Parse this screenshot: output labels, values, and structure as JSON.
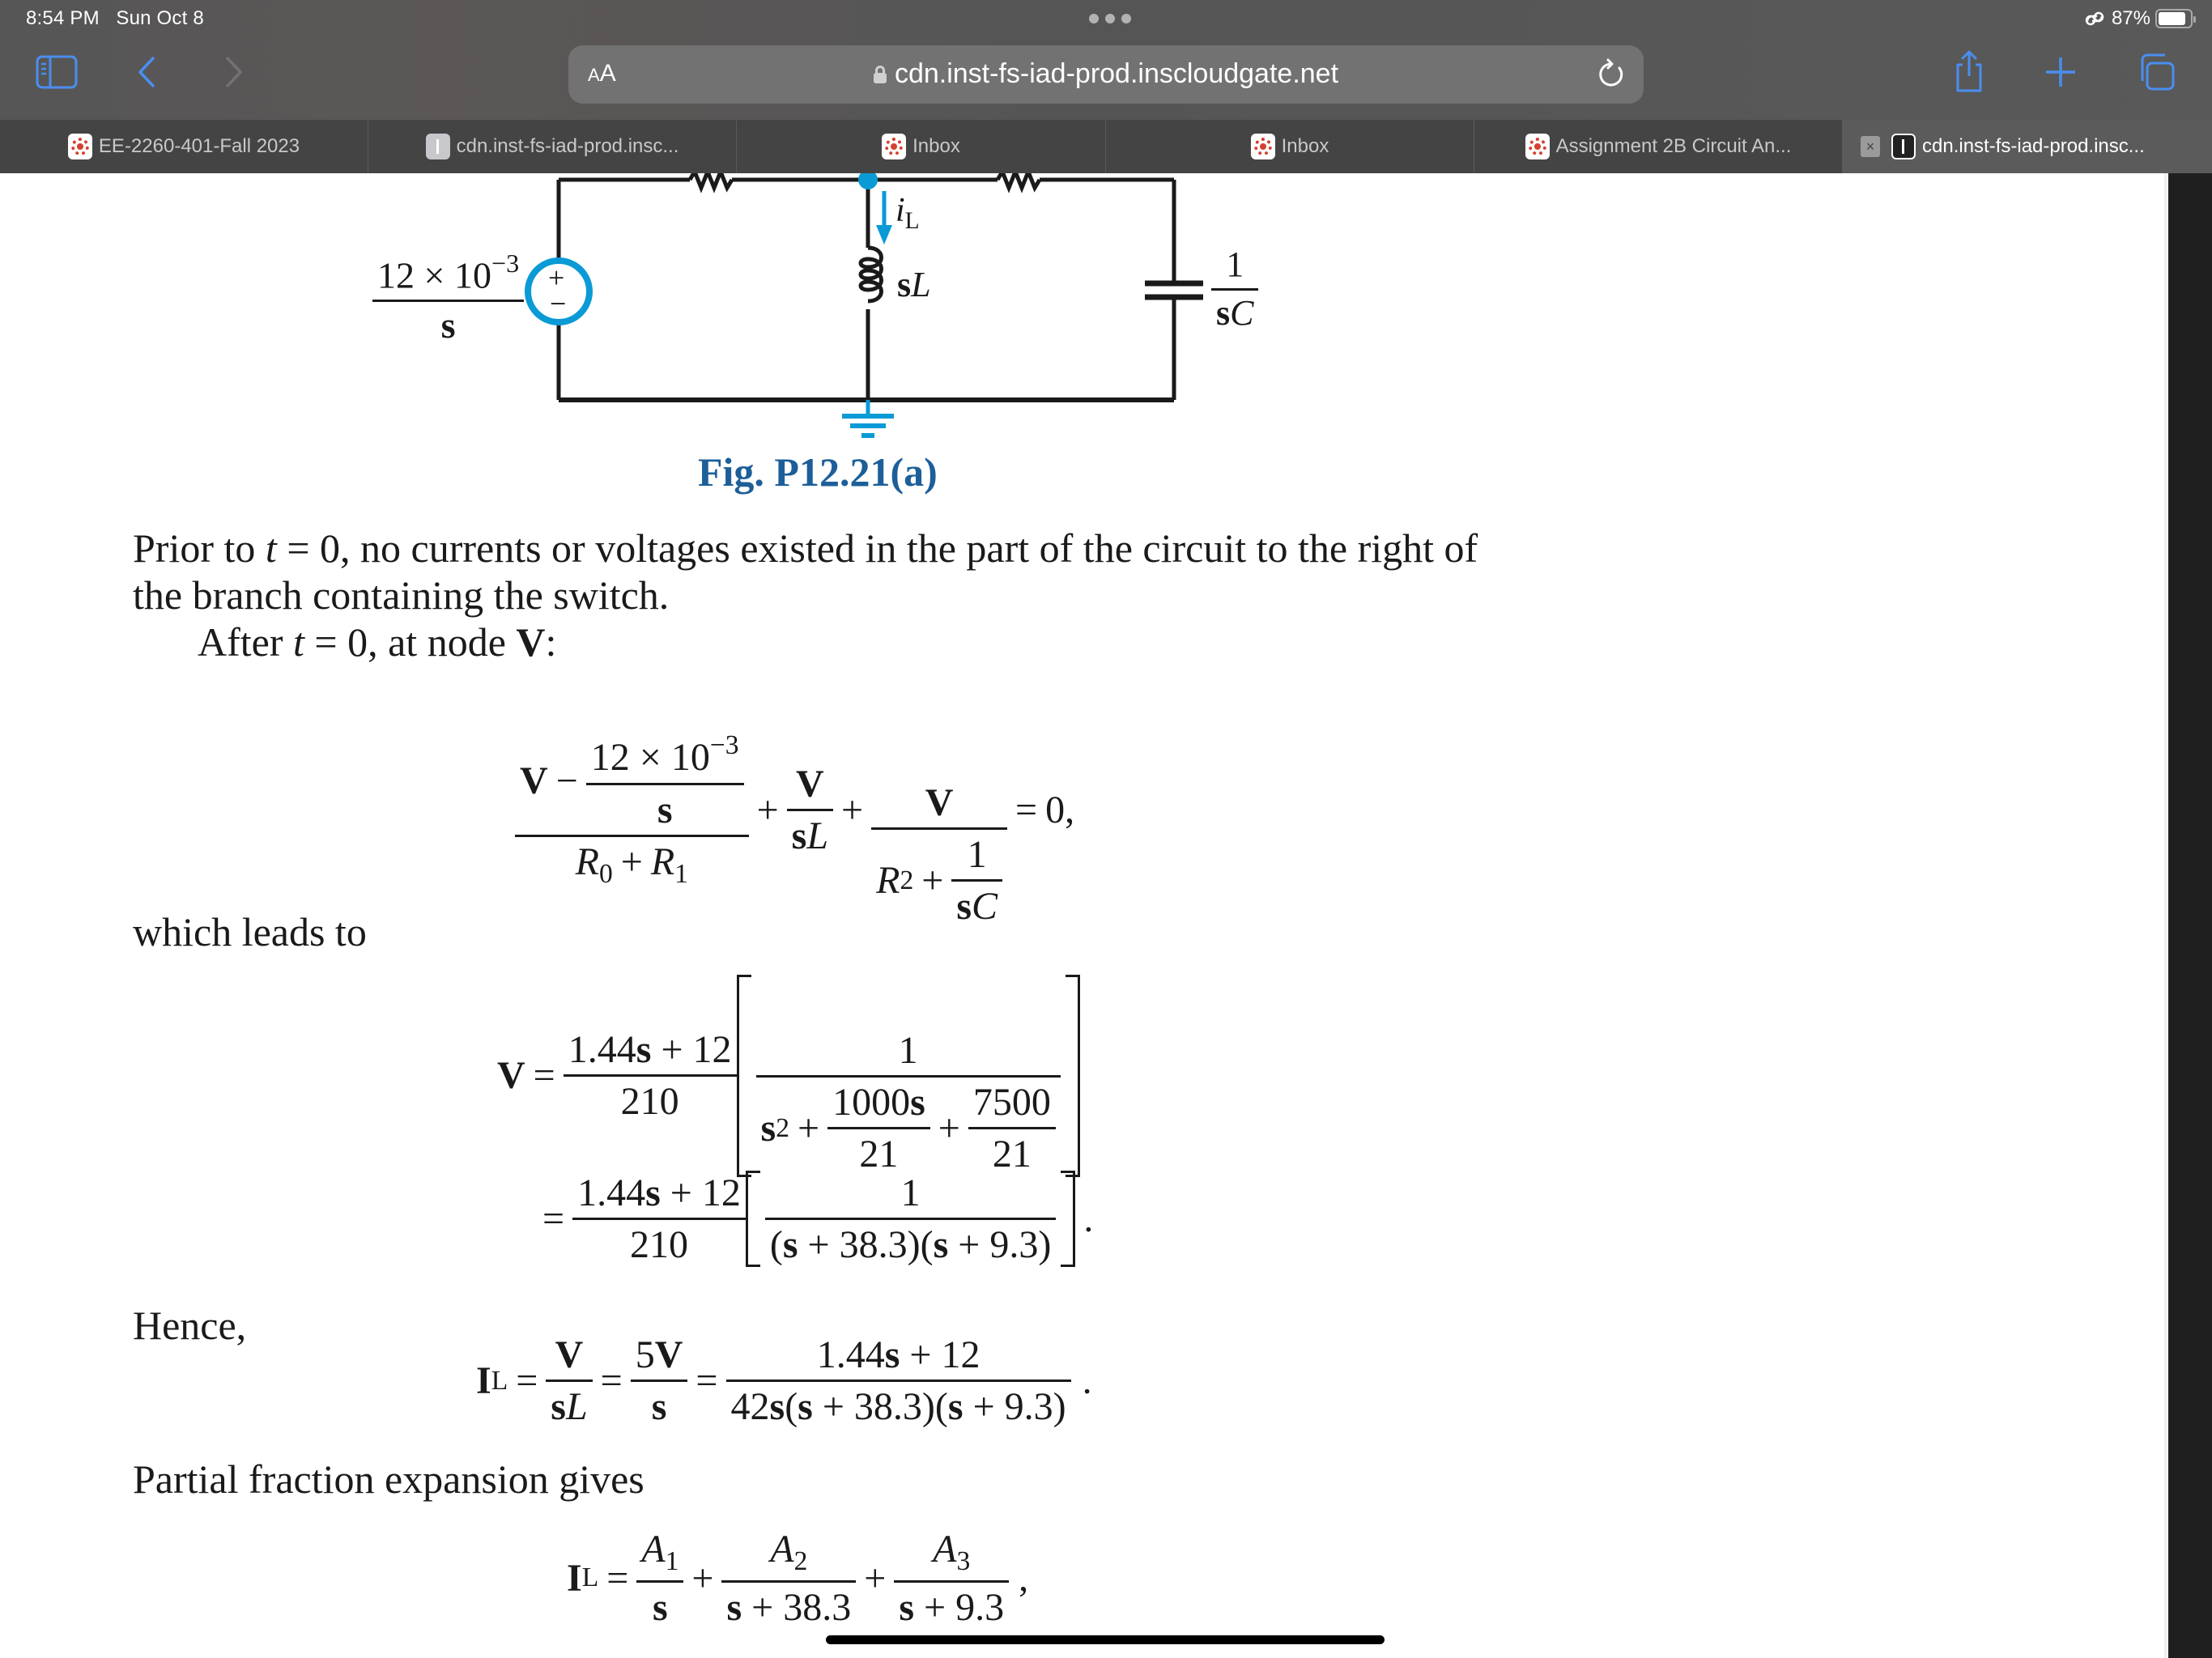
{
  "status_bar": {
    "time": "8:54 PM",
    "date": "Sun Oct 8",
    "battery_percent": "87%",
    "battery_level": 0.87
  },
  "toolbar": {
    "text_size_label": "AA",
    "url": "cdn.inst-fs-iad-prod.inscloudgate.net",
    "accent_color": "#4a8ef0"
  },
  "tabs": [
    {
      "label": "EE-2260-401-Fall 2023",
      "favicon": "canvas-icon",
      "active": false
    },
    {
      "label": "cdn.inst-fs-iad-prod.insc...",
      "favicon": "document-icon",
      "active": false
    },
    {
      "label": "Inbox",
      "favicon": "canvas-icon",
      "active": false
    },
    {
      "label": "Inbox",
      "favicon": "canvas-icon",
      "active": false
    },
    {
      "label": "Assignment 2B Circuit An...",
      "favicon": "canvas-icon",
      "active": false
    },
    {
      "label": "cdn.inst-fs-iad-prod.insc...",
      "favicon": "document-icon",
      "active": true,
      "close_label": "×"
    }
  ],
  "figure": {
    "source_label_num": "12 × 10",
    "source_label_exp": "−3",
    "source_label_den": "s",
    "source_plus": "+",
    "source_minus": "−",
    "current_label": "i",
    "current_sub": "L",
    "inductor_label_s": "s",
    "inductor_label_L": "L",
    "capacitor_num": "1",
    "capacitor_den_s": "s",
    "capacitor_den_C": "C",
    "caption": "Fig. P12.21(a)",
    "accent_color": "#0a9ad6",
    "caption_color": "#1d5f98"
  },
  "text": {
    "para1_line1_a": "Prior to ",
    "para1_t": "t",
    "para1_line1_b": " = 0, no currents or voltages existed in the part of the circuit to the right of",
    "para1_line2": "the branch containing the switch.",
    "para2_a": "After ",
    "para2_t": "t",
    "para2_b": " = 0, at node ",
    "para2_V": "V",
    "para2_c": ":",
    "leads_to": "which leads to",
    "hence": "Hence,",
    "partial": "Partial fraction expansion gives"
  },
  "eq1": {
    "V": "V",
    "minus": "−",
    "src_num": "12 × 10",
    "src_exp": "−3",
    "src_den": "s",
    "R0": "R",
    "R0_sub": "0",
    "plus": "+",
    "R1": "R",
    "R1_sub": "1",
    "t2_num": "V",
    "t2_den_s": "s",
    "t2_den_L": "L",
    "t3_num": "V",
    "R2": "R",
    "R2_sub": "2",
    "one": "1",
    "sC_s": "s",
    "sC_C": "C",
    "equals": "=",
    "rhs": "0,"
  },
  "eq2": {
    "V": "V",
    "equals": "=",
    "num_a": "1.44",
    "num_s": "s",
    "num_b": " + 12",
    "den": "210",
    "inner_num": "1",
    "s2_s": "s",
    "s2_exp": "2",
    "plus": "+",
    "f1_num_a": "1000",
    "f1_num_s": "s",
    "f1_den": "21",
    "f2_num": "7500",
    "f2_den": "21"
  },
  "eq3": {
    "equals": "=",
    "num_a": "1.44",
    "num_s": "s",
    "num_b": " + 12",
    "den": "210",
    "inner_num": "1",
    "inner_den_1": "(",
    "inner_s1": "s",
    "inner_den_2": " + 38.3)(",
    "inner_s2": "s",
    "inner_den_3": " + 9.3)",
    "period": "."
  },
  "eq4": {
    "I": "I",
    "I_sub": "L",
    "equals": "=",
    "f1_num": "V",
    "f1_den_s": "s",
    "f1_den_L": "L",
    "f2_num_a": "5",
    "f2_num_V": "V",
    "f2_den": "s",
    "f3_num_a": "1.44",
    "f3_num_s": "s",
    "f3_num_b": " + 12",
    "f3_den_a": "42",
    "f3_den_s1": "s",
    "f3_den_b": "(",
    "f3_den_s2": "s",
    "f3_den_c": " + 38.3)(",
    "f3_den_s3": "s",
    "f3_den_d": " + 9.3)",
    "period": "."
  },
  "eq5": {
    "I": "I",
    "I_sub": "L",
    "equals": "=",
    "A": "A",
    "A1_sub": "1",
    "A2_sub": "2",
    "A3_sub": "3",
    "d1_s": "s",
    "d2_s": "s",
    "d2_rest": " + 38.3",
    "d3_s": "s",
    "d3_rest": " + 9.3",
    "plus": "+",
    "comma": ","
  }
}
